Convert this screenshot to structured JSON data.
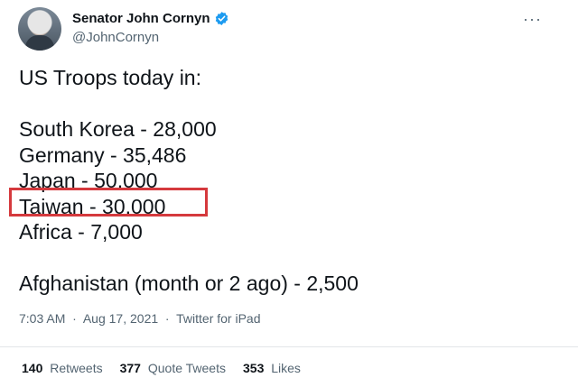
{
  "author": {
    "display_name": "Senator John Cornyn",
    "handle": "@JohnCornyn",
    "avatar_icon": "avatar-photo",
    "verified_icon": "verified-badge-icon",
    "verified_color": "#1d9bf0"
  },
  "more_icon": "more-options-icon",
  "tweet": {
    "intro": "US Troops today in:",
    "lines": [
      "South Korea - 28,000",
      "Germany - 35,486",
      "Japan - 50,000",
      "Taiwan - 30,000",
      "Africa - 7,000"
    ],
    "afghanistan": "Afghanistan (month or 2 ago) - 2,500",
    "highlight_color": "#d5393d"
  },
  "meta": {
    "time": "7:03 AM",
    "separator": "·",
    "date": "Aug 17, 2021",
    "source": "Twitter for iPad"
  },
  "stats": {
    "retweets_count": "140",
    "retweets_label": "Retweets",
    "quotes_count": "377",
    "quotes_label": "Quote Tweets",
    "likes_count": "353",
    "likes_label": "Likes"
  }
}
